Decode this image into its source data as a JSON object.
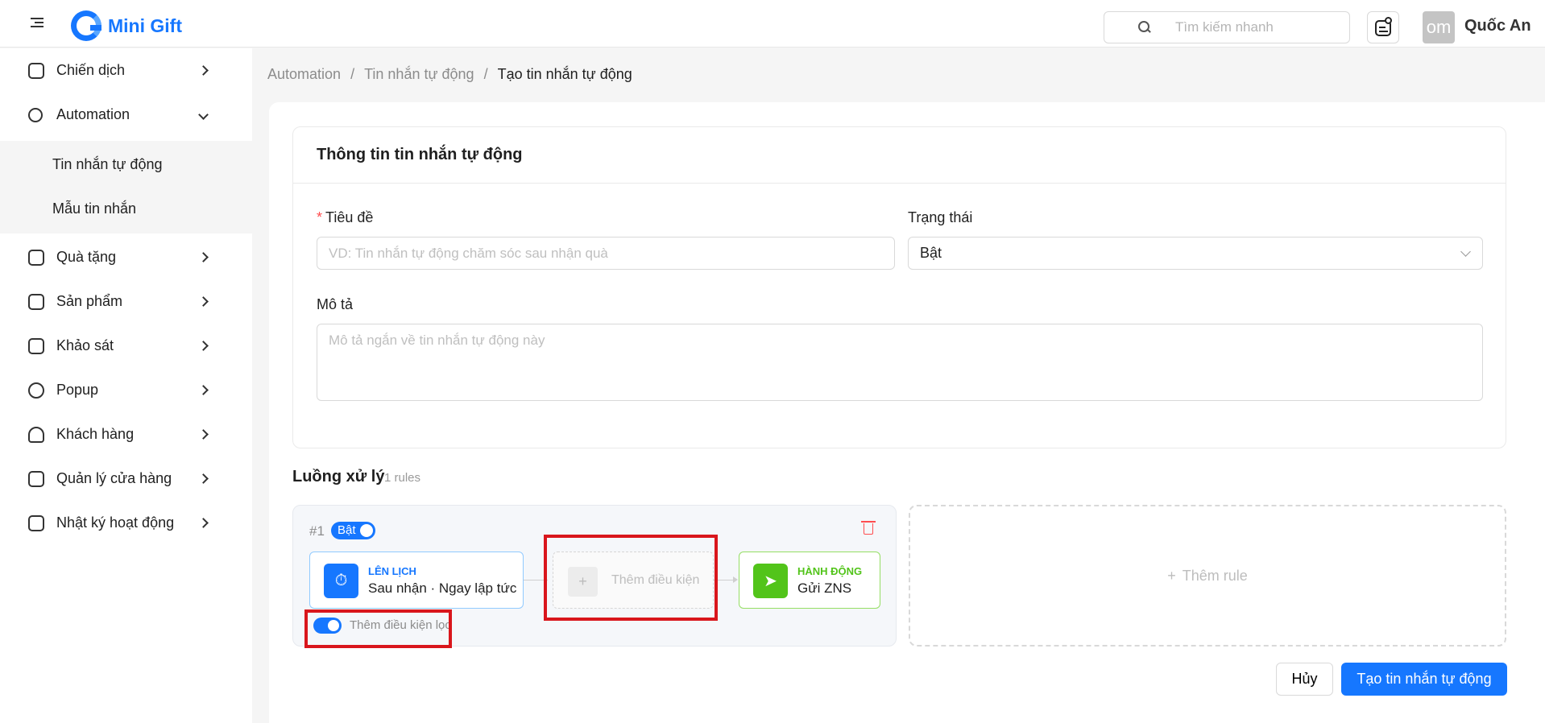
{
  "header": {
    "brand": "Mini Gift",
    "search_placeholder": "Tìm kiếm nhanh",
    "avatar_text": "om",
    "user_name": "Quốc An"
  },
  "sidebar": {
    "items": [
      {
        "label": "Chiến dịch",
        "icon": "calendar-icon"
      },
      {
        "label": "Automation",
        "icon": "workflow-icon",
        "expanded": true
      },
      {
        "label": "Quà tặng",
        "icon": "gift-icon"
      },
      {
        "label": "Sản phẩm",
        "icon": "box-icon"
      },
      {
        "label": "Khảo sát",
        "icon": "survey-icon"
      },
      {
        "label": "Popup",
        "icon": "popup-icon"
      },
      {
        "label": "Khách hàng",
        "icon": "users-icon"
      },
      {
        "label": "Quản lý cửa hàng",
        "icon": "store-icon"
      },
      {
        "label": "Nhật ký hoạt động",
        "icon": "log-icon"
      }
    ],
    "automation_sub": [
      {
        "label": "Tin nhắn tự động"
      },
      {
        "label": "Mẫu tin nhắn"
      }
    ]
  },
  "breadcrumb": {
    "items": [
      "Automation",
      "/",
      "Tin nhắn tự động",
      "/",
      "Tạo tin nhắn tự động"
    ]
  },
  "form": {
    "title": "Thông tin tin nhắn tự động",
    "title_label": "Tiêu đề",
    "title_required": "*",
    "title_placeholder": "VD: Tin nhắn tự động chăm sóc sau nhận quà",
    "status_label": "Trạng thái",
    "status_value": "Bật",
    "desc_label": "Mô tả",
    "desc_placeholder": "Mô tả ngắn về tin nhắn tự động này"
  },
  "flow": {
    "title": "Luồng xử lý",
    "count": "1 rules",
    "rule": {
      "number": "#1",
      "toggle_label": "Bật",
      "trigger_kicker": "LÊN LỊCH",
      "trigger_text": "Sau nhận · Ngay lập tức",
      "add_condition": "Thêm điều kiện",
      "add_condition_icon": "+",
      "action_kicker": "HÀNH ĐỘNG",
      "action_text": "Gửi ZNS",
      "filter_label": "Thêm điều kiện lọc"
    },
    "add_rule": "Thêm rule",
    "add_rule_icon": "+"
  },
  "actions": {
    "cancel": "Hủy",
    "submit": "Tạo tin nhắn tự động"
  },
  "colors": {
    "primary": "#1677ff",
    "success": "#52c41a",
    "highlight": "#d9161c"
  }
}
